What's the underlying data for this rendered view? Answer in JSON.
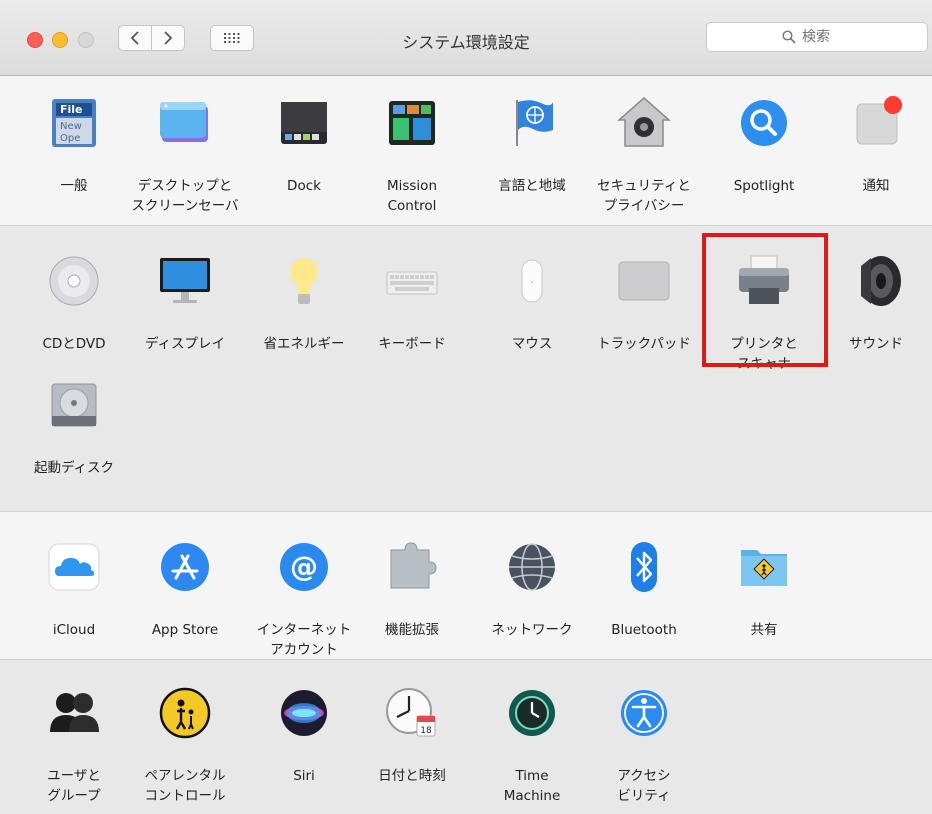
{
  "window": {
    "title": "システム環境設定"
  },
  "toolbar": {
    "search_placeholder": "検索"
  },
  "sections": [
    {
      "panes": [
        {
          "name": "pane-general",
          "label": "一般",
          "icon": "general-icon"
        },
        {
          "name": "pane-desktop-screensaver",
          "label": "デスクトップと\nスクリーンセーバ",
          "icon": "desktop-icon"
        },
        {
          "name": "pane-dock",
          "label": "Dock",
          "icon": "dock-icon"
        },
        {
          "name": "pane-mission-control",
          "label": "Mission\nControl",
          "icon": "mission-control-icon"
        },
        {
          "name": "pane-language-region",
          "label": "言語と地域",
          "icon": "flag-icon"
        },
        {
          "name": "pane-security-privacy",
          "label": "セキュリティと\nプライバシー",
          "icon": "house-lock-icon"
        },
        {
          "name": "pane-spotlight",
          "label": "Spotlight",
          "icon": "magnifier-icon"
        },
        {
          "name": "pane-notifications",
          "label": "通知",
          "icon": "notifications-icon"
        }
      ]
    },
    {
      "panes": [
        {
          "name": "pane-cd-dvd",
          "label": "CDとDVD",
          "icon": "disc-icon"
        },
        {
          "name": "pane-displays",
          "label": "ディスプレイ",
          "icon": "display-icon"
        },
        {
          "name": "pane-energy-saver",
          "label": "省エネルギー",
          "icon": "lightbulb-icon"
        },
        {
          "name": "pane-keyboard",
          "label": "キーボード",
          "icon": "keyboard-icon"
        },
        {
          "name": "pane-mouse",
          "label": "マウス",
          "icon": "mouse-icon"
        },
        {
          "name": "pane-trackpad",
          "label": "トラックパッド",
          "icon": "trackpad-icon"
        },
        {
          "name": "pane-printers-scanners",
          "label": "プリンタと\nスキャナ",
          "icon": "printer-icon"
        },
        {
          "name": "pane-sound",
          "label": "サウンド",
          "icon": "speaker-icon"
        },
        {
          "name": "pane-startup-disk",
          "label": "起動ディスク",
          "icon": "hard-drive-icon"
        }
      ]
    },
    {
      "panes": [
        {
          "name": "pane-icloud",
          "label": "iCloud",
          "icon": "cloud-icon"
        },
        {
          "name": "pane-app-store",
          "label": "App Store",
          "icon": "app-store-icon"
        },
        {
          "name": "pane-internet-accounts",
          "label": "インターネット\nアカウント",
          "icon": "at-sign-icon"
        },
        {
          "name": "pane-extensions",
          "label": "機能拡張",
          "icon": "puzzle-icon"
        },
        {
          "name": "pane-network",
          "label": "ネットワーク",
          "icon": "globe-icon"
        },
        {
          "name": "pane-bluetooth",
          "label": "Bluetooth",
          "icon": "bluetooth-icon"
        },
        {
          "name": "pane-sharing",
          "label": "共有",
          "icon": "folder-sign-icon"
        }
      ]
    },
    {
      "panes": [
        {
          "name": "pane-users-groups",
          "label": "ユーザと\nグループ",
          "icon": "users-icon"
        },
        {
          "name": "pane-parental-controls",
          "label": "ペアレンタル\nコントロール",
          "icon": "parental-icon"
        },
        {
          "name": "pane-siri",
          "label": "Siri",
          "icon": "siri-icon"
        },
        {
          "name": "pane-date-time",
          "label": "日付と時刻",
          "icon": "clock-calendar-icon"
        },
        {
          "name": "pane-time-machine",
          "label": "Time\nMachine",
          "icon": "time-machine-icon"
        },
        {
          "name": "pane-accessibility",
          "label": "アクセシ\nビリティ",
          "icon": "accessibility-icon"
        }
      ]
    }
  ],
  "highlight": {
    "target": "pane-printers-scanners",
    "color": "#e01818"
  },
  "colors": {
    "close": "#fc5f57",
    "minimize": "#fdbc2e",
    "zoom": "#d8d8d8"
  }
}
